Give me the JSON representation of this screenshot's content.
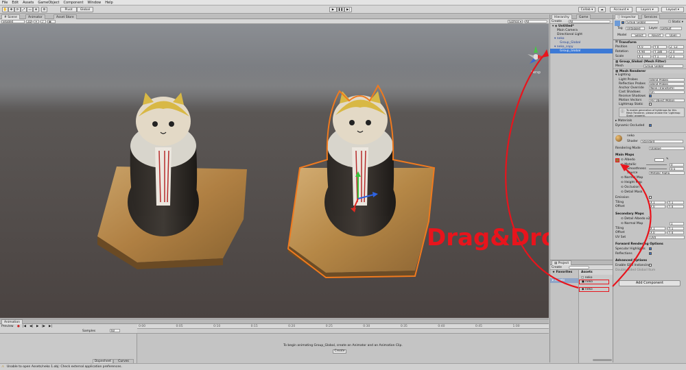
{
  "menu": [
    "File",
    "Edit",
    "Assets",
    "GameObject",
    "Component",
    "Window",
    "Help"
  ],
  "toolbar": {
    "pivot": "Pivot",
    "global": "Global",
    "collab": "Collab ▾",
    "account": "Account ▾",
    "layers": "Layers",
    "layout": "Layout"
  },
  "scene": {
    "tabs": [
      "Scene",
      "Animator",
      "Asset Store"
    ],
    "shading": "Shaded",
    "mode_2d": "2D",
    "gizmos": "Gizmos ▾",
    "search_placeholder": "All",
    "persp": "Persp",
    "annotation": "Drag&Drop"
  },
  "hierarchy": {
    "tabs": [
      "Hierarchy",
      "Game"
    ],
    "create": "Create",
    "search_placeholder": "All",
    "items": [
      {
        "label": "Untitled*"
      },
      {
        "label": "Main Camera"
      },
      {
        "label": "Directional Light"
      },
      {
        "label": "neko"
      },
      {
        "label": "Group_Global"
      },
      {
        "label": "neko_copy"
      },
      {
        "label": "Group_Global"
      }
    ]
  },
  "project": {
    "tab": "Project",
    "create": "Create",
    "favorites": "Favorites",
    "assets": "Assets",
    "assets_left": "Assets",
    "files": [
      "neko",
      "neko",
      "neko"
    ]
  },
  "inspector": {
    "tabs": [
      "Inspector",
      "Services"
    ],
    "object_name": "Group_Global",
    "static": "Static",
    "tag_label": "Tag",
    "tag_value": "Untagged",
    "layer_label": "Layer",
    "layer_value": "Default",
    "model_label": "Model",
    "model_buttons": [
      "Select",
      "Revert",
      "Open"
    ],
    "transform": {
      "title": "Transform",
      "rows": [
        {
          "label": "Position",
          "x": "0",
          "y": "0",
          "z": "-13"
        },
        {
          "label": "Rotation",
          "x": "90",
          "y": "180",
          "z": "0"
        },
        {
          "label": "Scale",
          "x": "1",
          "y": "1",
          "z": "1"
        }
      ]
    },
    "mesh_filter": {
      "title": "Group_Global (Mesh Filter)",
      "mesh_label": "Mesh",
      "mesh_value": "Group_Global"
    },
    "mesh_renderer": {
      "title": "Mesh Renderer",
      "lighting": "Lighting",
      "rows": [
        {
          "label": "Light Probes",
          "value": "Blend Probes"
        },
        {
          "label": "Reflection Probes",
          "value": "Blend Probes"
        },
        {
          "label": "Anchor Override",
          "value": "None (Transform)"
        },
        {
          "label": "Cast Shadows",
          "value": "On"
        },
        {
          "label": "Receive Shadows",
          "value": ""
        },
        {
          "label": "Motion Vectors",
          "value": "Per Object Motion"
        },
        {
          "label": "Lightmap Static",
          "value": ""
        }
      ],
      "info": "To enable generation of lightmaps for this Mesh Renderer, please enable the 'Lightmap Static' property.",
      "materials": "Materials",
      "dynamic_occluded": "Dynamic Occluded"
    },
    "material": {
      "name": "neko",
      "shader_label": "Shader",
      "shader_value": "Standard",
      "rendering_mode_label": "Rendering Mode",
      "rendering_mode_value": "Opaque",
      "main_maps": "Main Maps",
      "rows": [
        "Albedo",
        "Metallic",
        "Smoothness",
        "Source",
        "Normal Map",
        "Height Map",
        "Occlusion",
        "Detail Mask",
        "Emission",
        "Tiling",
        "Offset"
      ],
      "metallic_value": "0",
      "smoothness_value": "0.5",
      "source_value": "Metallic Alpha",
      "tiling": {
        "x": "1",
        "y": "1"
      },
      "offset": {
        "x": "0",
        "y": "0"
      },
      "secondary_maps": "Secondary Maps",
      "secondary_rows": [
        "Detail Albedo x2",
        "Normal Map",
        "Tiling",
        "Offset",
        "UV Set"
      ],
      "secondary_normal_value": "1",
      "sec_tiling": {
        "x": "1",
        "y": "1"
      },
      "sec_offset": {
        "x": "0",
        "y": "0"
      },
      "uv_set_value": "UV0",
      "forward": "Forward Rendering Options",
      "forward_rows": [
        "Specular Highlights",
        "Reflections"
      ],
      "advanced": "Advanced Options",
      "advanced_rows": [
        "Enable GPU Instancing",
        "Double Sided Global Illum"
      ],
      "add_component": "Add Component"
    }
  },
  "animation": {
    "tab": "Animation",
    "preview": "Preview",
    "samples_label": "Samples",
    "samples_value": "60",
    "ruler": [
      "0:00",
      "0:05",
      "0:10",
      "0:15",
      "0:20",
      "0:25",
      "0:30",
      "0:35",
      "0:40",
      "0:45",
      "1:00"
    ],
    "message": "To begin animating Group_Global, create an Animator and an Animation Clip.",
    "create": "Create",
    "dopesheet": "Dopesheet",
    "curves": "Curves"
  },
  "status": {
    "text": "Unable to open Assets/neko 1.obj: Check external application preferences."
  },
  "colors": {
    "annotation": "#e8141c",
    "selection": "#3d7ad6",
    "outline": "#f07a1e"
  }
}
